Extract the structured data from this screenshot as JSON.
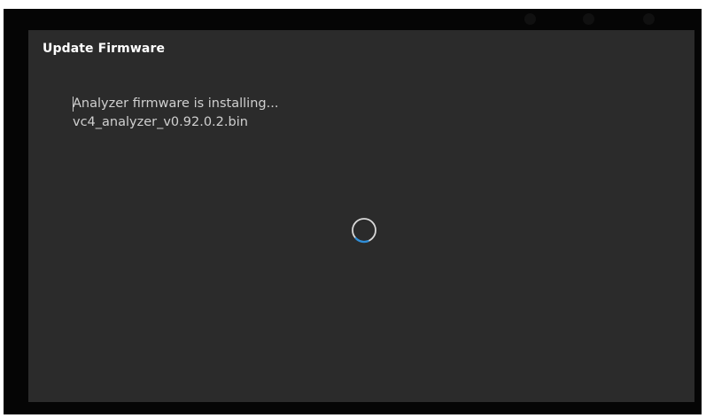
{
  "dialog": {
    "title": "Update Firmware",
    "message_line1": "Analyzer firmware is installing...",
    "message_line2": "vc4_analyzer_v0.92.0.2.bin"
  },
  "spinner": {
    "icon": "loading-spinner-icon",
    "color": "#2f8ed8",
    "track_color": "#d9d9d9"
  },
  "colors": {
    "screen_background": "#050505",
    "dialog_background": "#2b2b2b",
    "title_text": "#ffffff",
    "message_text": "#d0d0d0"
  }
}
